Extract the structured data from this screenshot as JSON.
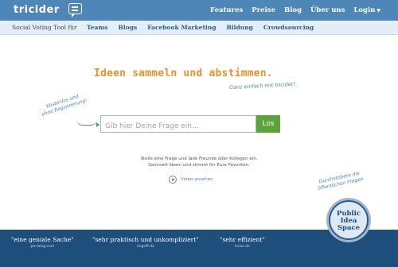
{
  "header": {
    "logo": "tricider",
    "nav": [
      "Features",
      "Preise",
      "Blog",
      "Über uns",
      "Login"
    ]
  },
  "subheader": {
    "tagline": "Social Voting Tool für",
    "items": [
      "Teams",
      "Blogs",
      "Facebook Marketing",
      "Bildung",
      "Crowdsourcing"
    ]
  },
  "hero": {
    "headline": "Ideen sammeln und abstimmen.",
    "subline": "Ganz einfach mit tricider!",
    "note_left_1": "Kostenlos und",
    "note_left_2": "ohne Registrierung!",
    "search_placeholder": "Gib hier Deine Frage ein...",
    "submit_label": "Los",
    "desc_1": "Stelle eine Frage und lade Freunde oder Kollegen ein.",
    "desc_2": "Sammelt Ideen und stimmt für Eure Favoriten.",
    "video_label": "Video ansehen",
    "note_right_1": "Durchstöbere die",
    "note_right_2": "öffentlichen Fragen"
  },
  "footer": {
    "quotes": [
      {
        "text": "\"eine geniale Sache\"",
        "source": "pm-blog.com"
      },
      {
        "text": "\"sehr praktisch und unkompliziert\"",
        "source": "imgriff.de"
      },
      {
        "text": "\"sehr effizient\"",
        "source": "heise.de"
      }
    ],
    "badge": [
      "Public",
      "Idea",
      "Space"
    ]
  },
  "colors": {
    "topbar": "#4f86b8",
    "accent_orange": "#f0902a",
    "button_green": "#5aa43a",
    "footer": "#1e4f7c"
  }
}
